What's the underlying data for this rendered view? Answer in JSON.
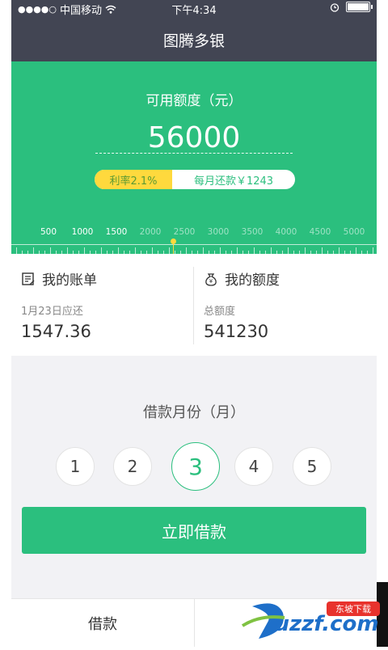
{
  "status_bar": {
    "signal_dots": "●●●●○",
    "carrier": "中国移动",
    "time": "下午4:34"
  },
  "nav": {
    "title": "图腾多银"
  },
  "hero": {
    "label": "可用额度（元）",
    "amount": "56000",
    "rate": "利率2.1%",
    "monthly_payment": "每月还款￥1243"
  },
  "ruler": {
    "ticks": [
      "500",
      "1000",
      "1500",
      "2000",
      "2500",
      "3000",
      "3500",
      "4000",
      "4500",
      "5000"
    ],
    "active_upto_index": 2
  },
  "bill": {
    "title": "我的账单",
    "due_label": "1月23日应还",
    "amount": "1547.36"
  },
  "quota": {
    "title": "我的额度",
    "total_label": "总额度",
    "amount": "541230"
  },
  "months": {
    "title": "借款月份（月）",
    "options": [
      "1",
      "2",
      "3",
      "4",
      "5"
    ],
    "selected": "3"
  },
  "actions": {
    "borrow_now": "立即借款"
  },
  "tabs": {
    "borrow": "借款"
  },
  "watermark": {
    "text": "uzzf.com",
    "tag": "东坡下载"
  },
  "colors": {
    "primary_green": "#2bbf7e",
    "header_dark": "#424553",
    "accent_yellow": "#ffd93d"
  }
}
